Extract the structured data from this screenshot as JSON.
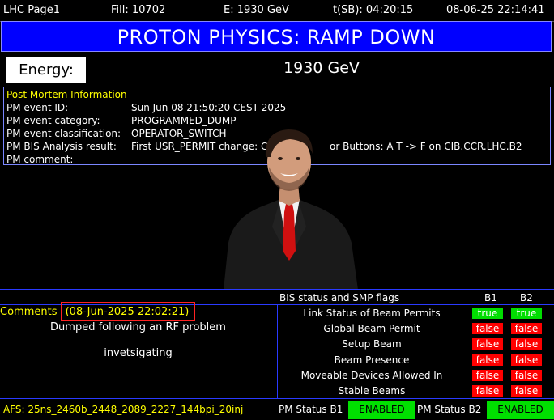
{
  "topbar": {
    "page": "LHC Page1",
    "fill": "Fill: 10702",
    "energy": "E:  1930 GeV",
    "tsb": "t(SB): 04:20:15",
    "datetime": "08-06-25 22:14:41"
  },
  "banner": {
    "title": "PROTON PHYSICS: RAMP DOWN"
  },
  "energy": {
    "label": "Energy:",
    "value": "1930 GeV"
  },
  "pm": {
    "title": "Post Mortem Information",
    "rows": [
      {
        "label": "PM event ID:",
        "value": "Sun Jun 08 21:50:20 CEST 2025"
      },
      {
        "label": "PM event category:",
        "value": "PROGRAMMED_DUMP"
      },
      {
        "label": "PM event classification:",
        "value": "OPERATOR_SWITCH"
      },
      {
        "label": "PM BIS Analysis result:",
        "value": "First USR_PERMIT change: Ch"
      },
      {
        "label": "PM comment:",
        "value": ""
      }
    ],
    "bis_result_tail": "or Buttons: A T -> F on CIB.CCR.LHC.B2"
  },
  "comments": {
    "label": "Comments",
    "date": "(08-Jun-2025 22:02:21)",
    "lines": [
      "Dumped following an RF problem",
      "invetsigating"
    ]
  },
  "bis": {
    "title": "BIS status and SMP flags",
    "b1_header": "B1",
    "b2_header": "B2",
    "rows": [
      {
        "label": "Link Status of Beam Permits",
        "b1": "true",
        "b2": "true"
      },
      {
        "label": "Global Beam Permit",
        "b1": "false",
        "b2": "false"
      },
      {
        "label": "Setup Beam",
        "b1": "false",
        "b2": "false"
      },
      {
        "label": "Beam Presence",
        "b1": "false",
        "b2": "false"
      },
      {
        "label": "Moveable Devices Allowed In",
        "b1": "false",
        "b2": "false"
      },
      {
        "label": "Stable Beams",
        "b1": "false",
        "b2": "false"
      }
    ]
  },
  "bottom": {
    "afs": "AFS: 25ns_2460b_2448_2089_2227_144bpi_20inj",
    "pm_b1_label": "PM Status B1",
    "pm_b1_status": "ENABLED",
    "pm_b2_label": "PM Status B2",
    "pm_b2_status": "ENABLED"
  },
  "colors": {
    "banner_bg": "#0000ff",
    "true_flag": "#00dd00",
    "false_flag": "#ff0000",
    "enabled": "#00e000",
    "highlight_text": "#ffff00"
  }
}
